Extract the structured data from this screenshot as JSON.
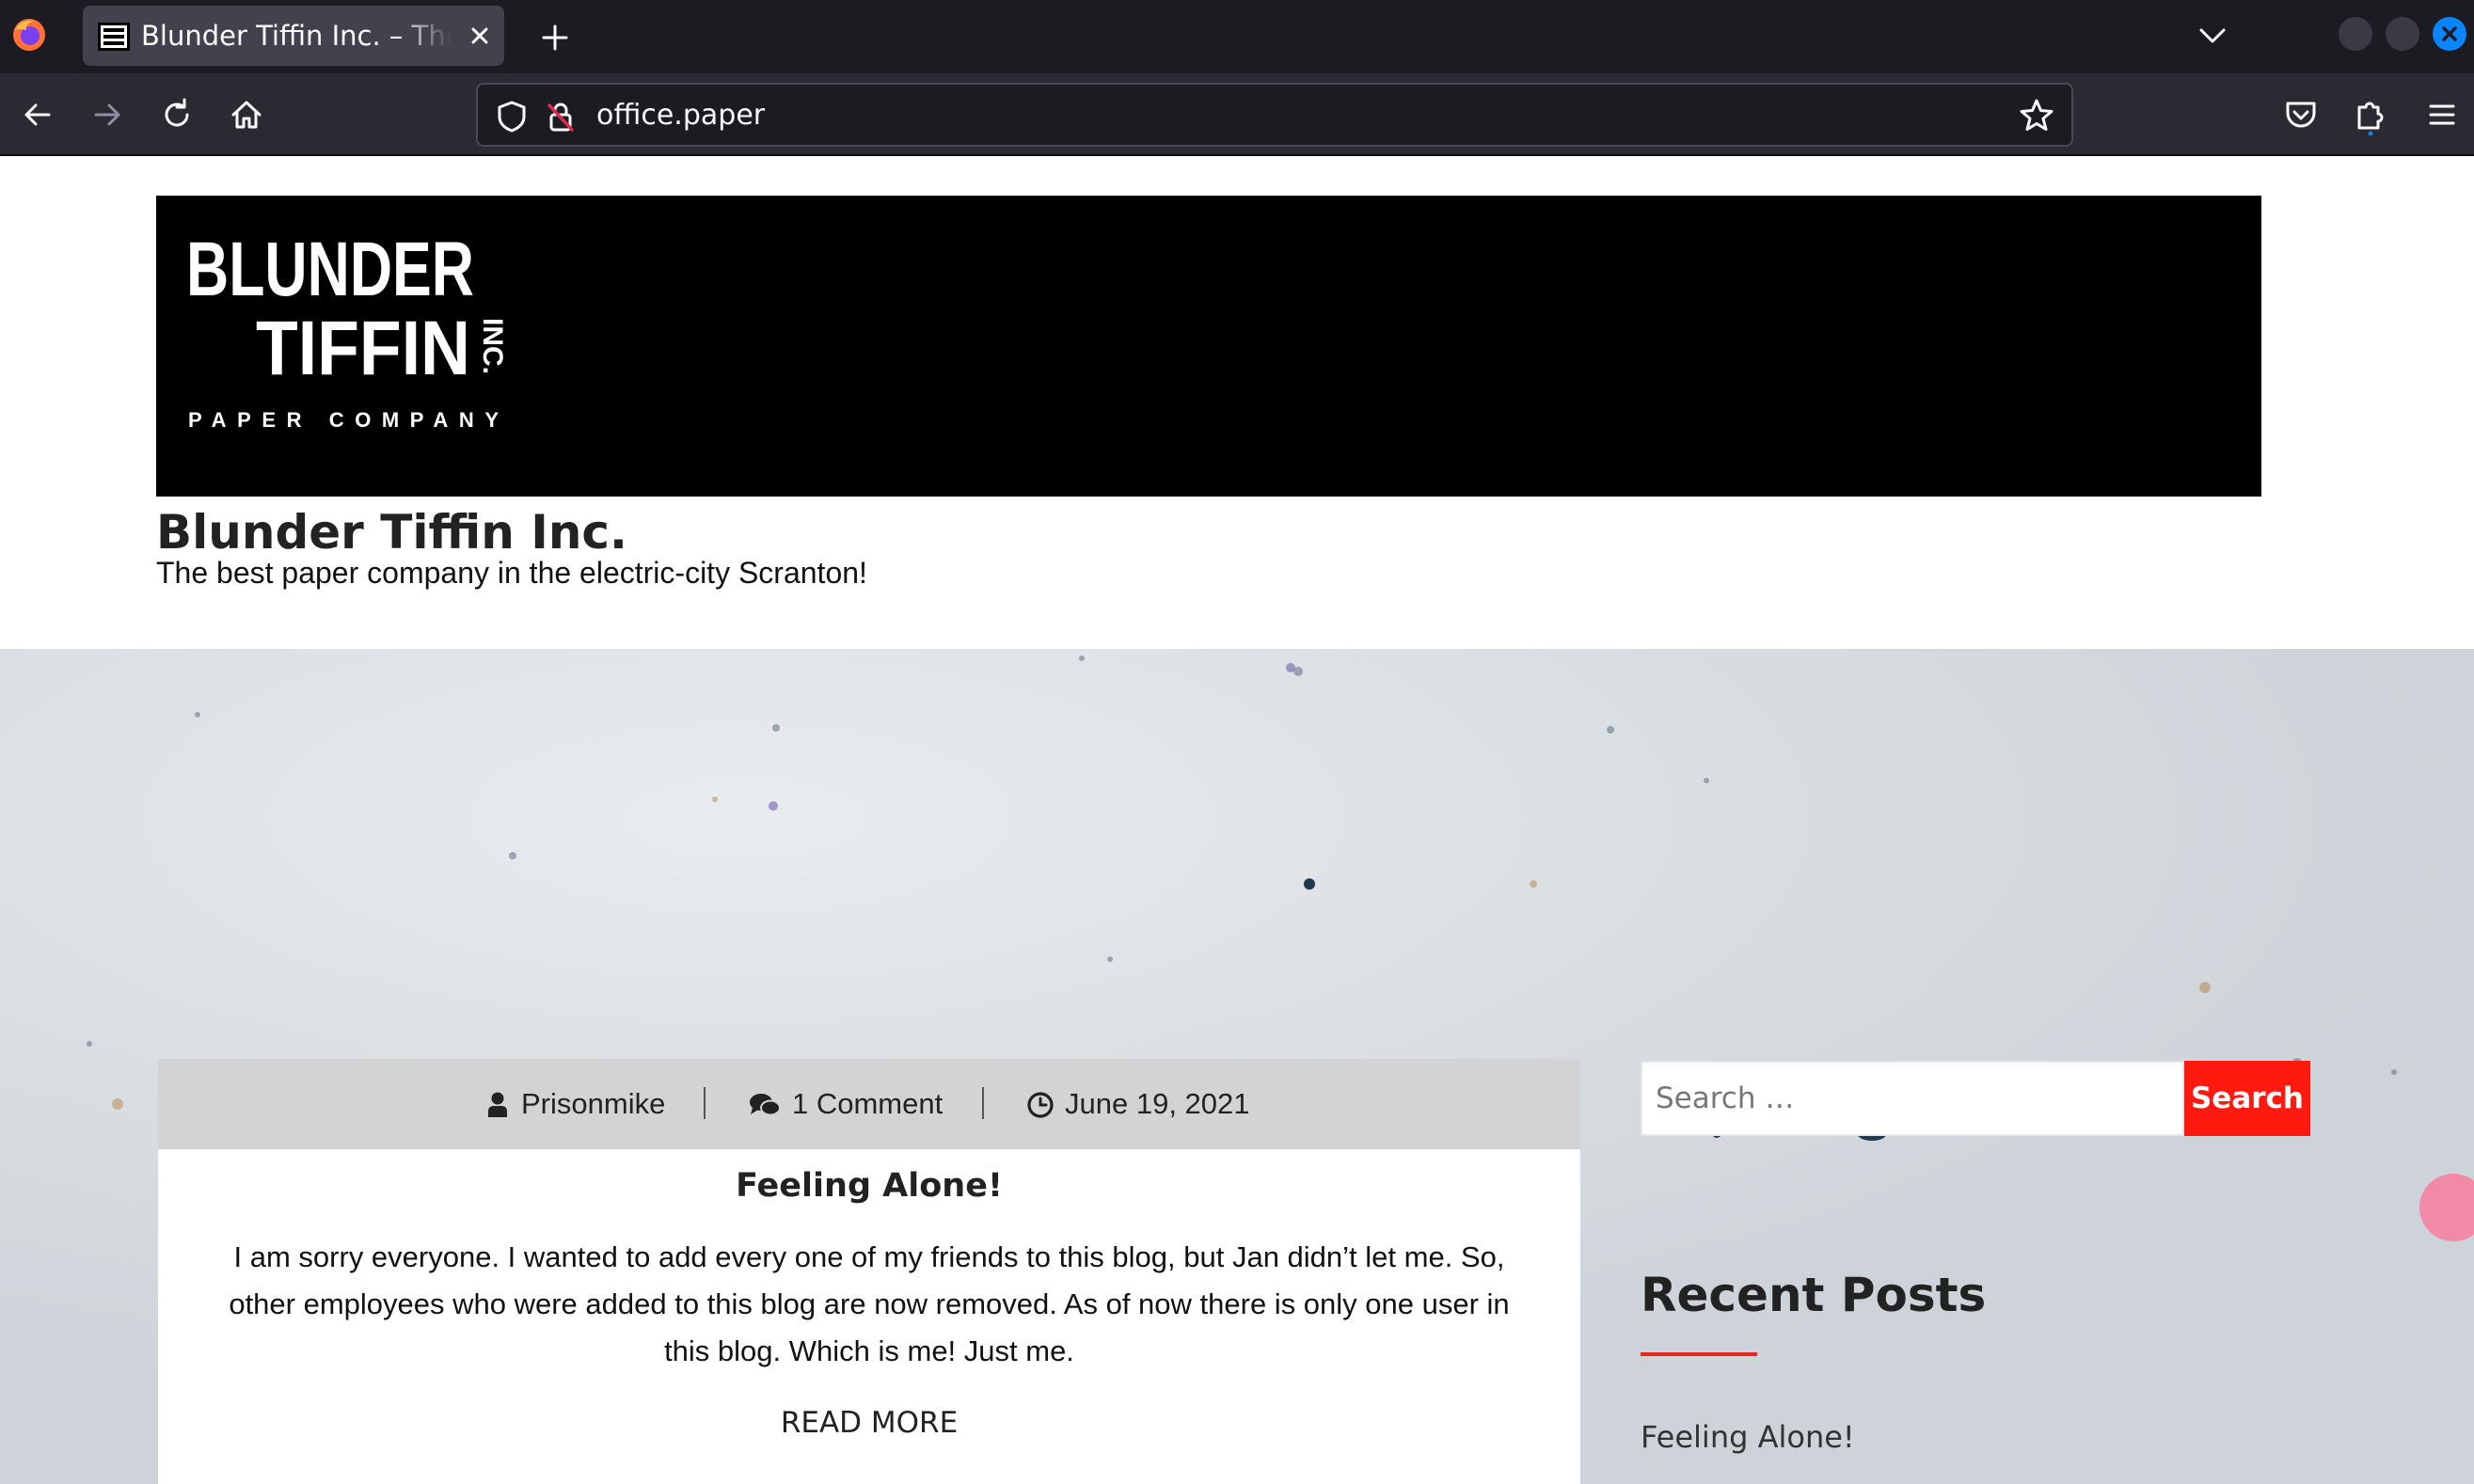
{
  "browser": {
    "tab_title": "Blunder Tiffin Inc. – The best paper company in the electric-city Scranton!",
    "url": "office.paper",
    "accent_color": "#0a84ff"
  },
  "icons": {
    "browser_logo": "firefox-icon",
    "back": "arrow-left-icon",
    "forward": "arrow-right-icon",
    "reload": "reload-icon",
    "home": "home-icon",
    "shield": "shield-icon",
    "lock": "lock-insecure-icon",
    "bookmark": "star-icon",
    "pocket": "pocket-icon",
    "extensions": "puzzle-icon",
    "menu": "hamburger-icon",
    "author": "user-icon",
    "comments": "comments-icon",
    "date": "clock-icon"
  },
  "site": {
    "logo_text": {
      "line1": "BLUNDER",
      "line2": "TIFFIN",
      "suffix": "INC.",
      "line3": "PAPER COMPANY"
    },
    "title": "Blunder Tiffin Inc.",
    "tagline": "The best paper company in the electric-city Scranton!"
  },
  "post": {
    "author": "Prisonmike",
    "comments": "1 Comment",
    "date": "June 19, 2021",
    "title": "Feeling Alone!",
    "excerpt": "I am sorry everyone. I wanted to add every one of my friends to this blog, but Jan didn’t let me. So, other employees who were added to this blog are now removed. As of now there is only one user in this blog. Which is me! Just me.",
    "read_more": "READ MORE"
  },
  "sidebar": {
    "search_placeholder": "Search …",
    "search_button": "Search",
    "recent_heading": "Recent Posts",
    "recent_posts": [
      "Feeling Alone!"
    ]
  },
  "colors": {
    "search_button": "#ff1a0f",
    "heading_underline": "#e4261c",
    "meta_bar": "#d3d3d3"
  }
}
